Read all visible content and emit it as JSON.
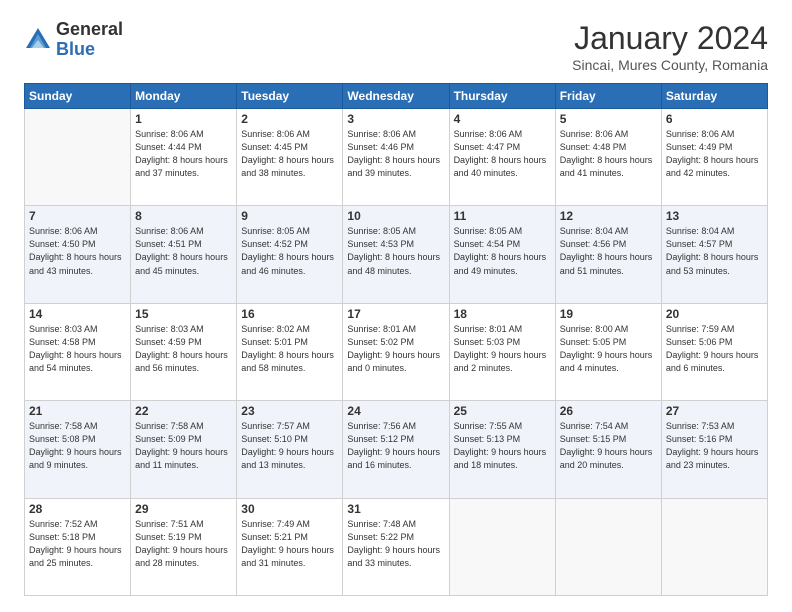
{
  "logo": {
    "general": "General",
    "blue": "Blue"
  },
  "title": "January 2024",
  "subtitle": "Sincai, Mures County, Romania",
  "days_header": [
    "Sunday",
    "Monday",
    "Tuesday",
    "Wednesday",
    "Thursday",
    "Friday",
    "Saturday"
  ],
  "weeks": [
    [
      {
        "day": "",
        "empty": true
      },
      {
        "day": "1",
        "sunrise": "8:06 AM",
        "sunset": "4:44 PM",
        "daylight": "8 hours and 37 minutes."
      },
      {
        "day": "2",
        "sunrise": "8:06 AM",
        "sunset": "4:45 PM",
        "daylight": "8 hours and 38 minutes."
      },
      {
        "day": "3",
        "sunrise": "8:06 AM",
        "sunset": "4:46 PM",
        "daylight": "8 hours and 39 minutes."
      },
      {
        "day": "4",
        "sunrise": "8:06 AM",
        "sunset": "4:47 PM",
        "daylight": "8 hours and 40 minutes."
      },
      {
        "day": "5",
        "sunrise": "8:06 AM",
        "sunset": "4:48 PM",
        "daylight": "8 hours and 41 minutes."
      },
      {
        "day": "6",
        "sunrise": "8:06 AM",
        "sunset": "4:49 PM",
        "daylight": "8 hours and 42 minutes."
      }
    ],
    [
      {
        "day": "7",
        "sunrise": "8:06 AM",
        "sunset": "4:50 PM",
        "daylight": "8 hours and 43 minutes."
      },
      {
        "day": "8",
        "sunrise": "8:06 AM",
        "sunset": "4:51 PM",
        "daylight": "8 hours and 45 minutes."
      },
      {
        "day": "9",
        "sunrise": "8:05 AM",
        "sunset": "4:52 PM",
        "daylight": "8 hours and 46 minutes."
      },
      {
        "day": "10",
        "sunrise": "8:05 AM",
        "sunset": "4:53 PM",
        "daylight": "8 hours and 48 minutes."
      },
      {
        "day": "11",
        "sunrise": "8:05 AM",
        "sunset": "4:54 PM",
        "daylight": "8 hours and 49 minutes."
      },
      {
        "day": "12",
        "sunrise": "8:04 AM",
        "sunset": "4:56 PM",
        "daylight": "8 hours and 51 minutes."
      },
      {
        "day": "13",
        "sunrise": "8:04 AM",
        "sunset": "4:57 PM",
        "daylight": "8 hours and 53 minutes."
      }
    ],
    [
      {
        "day": "14",
        "sunrise": "8:03 AM",
        "sunset": "4:58 PM",
        "daylight": "8 hours and 54 minutes."
      },
      {
        "day": "15",
        "sunrise": "8:03 AM",
        "sunset": "4:59 PM",
        "daylight": "8 hours and 56 minutes."
      },
      {
        "day": "16",
        "sunrise": "8:02 AM",
        "sunset": "5:01 PM",
        "daylight": "8 hours and 58 minutes."
      },
      {
        "day": "17",
        "sunrise": "8:01 AM",
        "sunset": "5:02 PM",
        "daylight": "9 hours and 0 minutes."
      },
      {
        "day": "18",
        "sunrise": "8:01 AM",
        "sunset": "5:03 PM",
        "daylight": "9 hours and 2 minutes."
      },
      {
        "day": "19",
        "sunrise": "8:00 AM",
        "sunset": "5:05 PM",
        "daylight": "9 hours and 4 minutes."
      },
      {
        "day": "20",
        "sunrise": "7:59 AM",
        "sunset": "5:06 PM",
        "daylight": "9 hours and 6 minutes."
      }
    ],
    [
      {
        "day": "21",
        "sunrise": "7:58 AM",
        "sunset": "5:08 PM",
        "daylight": "9 hours and 9 minutes."
      },
      {
        "day": "22",
        "sunrise": "7:58 AM",
        "sunset": "5:09 PM",
        "daylight": "9 hours and 11 minutes."
      },
      {
        "day": "23",
        "sunrise": "7:57 AM",
        "sunset": "5:10 PM",
        "daylight": "9 hours and 13 minutes."
      },
      {
        "day": "24",
        "sunrise": "7:56 AM",
        "sunset": "5:12 PM",
        "daylight": "9 hours and 16 minutes."
      },
      {
        "day": "25",
        "sunrise": "7:55 AM",
        "sunset": "5:13 PM",
        "daylight": "9 hours and 18 minutes."
      },
      {
        "day": "26",
        "sunrise": "7:54 AM",
        "sunset": "5:15 PM",
        "daylight": "9 hours and 20 minutes."
      },
      {
        "day": "27",
        "sunrise": "7:53 AM",
        "sunset": "5:16 PM",
        "daylight": "9 hours and 23 minutes."
      }
    ],
    [
      {
        "day": "28",
        "sunrise": "7:52 AM",
        "sunset": "5:18 PM",
        "daylight": "9 hours and 25 minutes."
      },
      {
        "day": "29",
        "sunrise": "7:51 AM",
        "sunset": "5:19 PM",
        "daylight": "9 hours and 28 minutes."
      },
      {
        "day": "30",
        "sunrise": "7:49 AM",
        "sunset": "5:21 PM",
        "daylight": "9 hours and 31 minutes."
      },
      {
        "day": "31",
        "sunrise": "7:48 AM",
        "sunset": "5:22 PM",
        "daylight": "9 hours and 33 minutes."
      },
      {
        "day": "",
        "empty": true
      },
      {
        "day": "",
        "empty": true
      },
      {
        "day": "",
        "empty": true
      }
    ]
  ]
}
